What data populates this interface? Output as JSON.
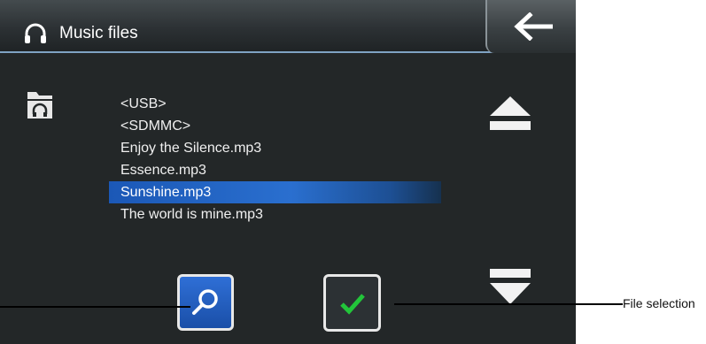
{
  "title_bar": {
    "title": "Music files",
    "icon": "headphones-icon",
    "back_icon": "back-arrow-icon"
  },
  "location_icon": "music-folder-icon",
  "file_list": {
    "items": [
      {
        "label": "<USB>",
        "selected": false
      },
      {
        "label": "<SDMMC>",
        "selected": false
      },
      {
        "label": "Enjoy the Silence.mp3",
        "selected": false
      },
      {
        "label": "Essence.mp3",
        "selected": false
      },
      {
        "label": "Sunshine.mp3",
        "selected": true
      },
      {
        "label": "The world is mine.mp3",
        "selected": false
      }
    ]
  },
  "controls": {
    "scroll_up_icon": "scroll-up-icon",
    "scroll_down_icon": "scroll-down-icon",
    "search_icon": "search-icon",
    "confirm_icon": "checkmark-icon"
  },
  "annotation": {
    "label": "File selection"
  },
  "colors": {
    "background": "#232728",
    "selection": "#2a6fcf",
    "search_button": "#2f6fd6",
    "checkmark": "#22c53a"
  }
}
